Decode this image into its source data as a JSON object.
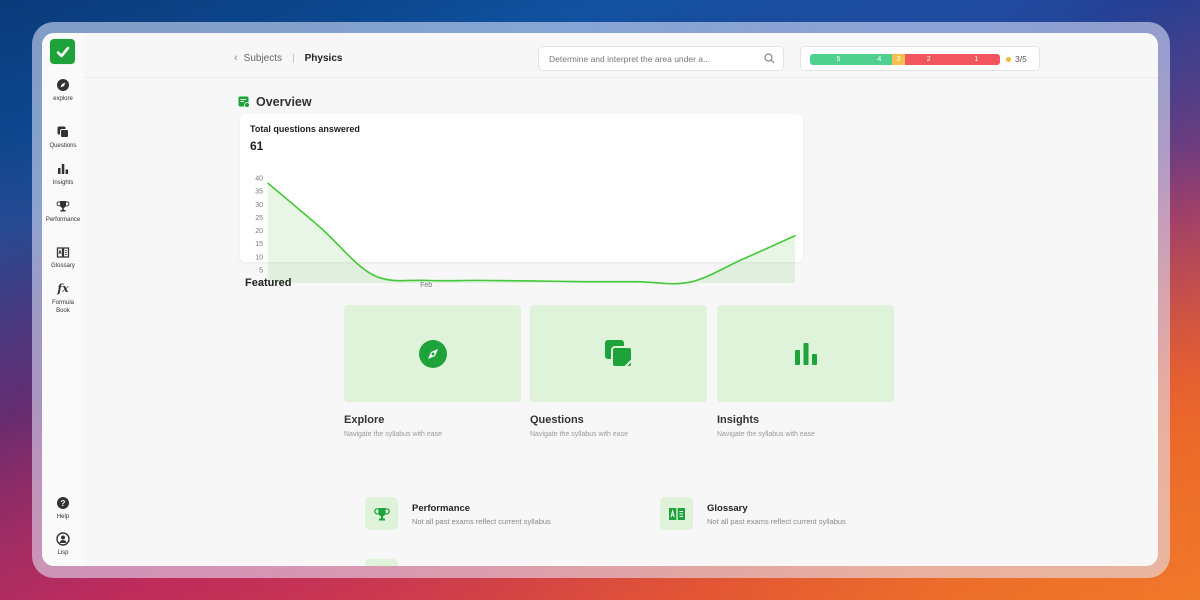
{
  "colors": {
    "accent": "#1ea23a",
    "card_bg": "#dff2da",
    "line": "#45c83a"
  },
  "sidebar": {
    "items": [
      {
        "label": "explore",
        "icon": "compass-icon"
      },
      {
        "label": "Questions",
        "icon": "cards-icon"
      },
      {
        "label": "Insights",
        "icon": "bar-chart-icon"
      },
      {
        "label": "Performance",
        "icon": "trophy-icon"
      },
      {
        "label": "Glossary",
        "icon": "book-icon"
      },
      {
        "label": "Formula Book",
        "icon": "fx-icon"
      }
    ],
    "bottom": [
      {
        "label": "Help",
        "icon": "help-icon"
      },
      {
        "label": "Lisp",
        "icon": "user-icon"
      }
    ]
  },
  "header": {
    "breadcrumb_parent": "Subjects",
    "breadcrumb_current": "Physics",
    "search_placeholder": "Determine and interpret the area under a...",
    "score_segments": [
      {
        "label": "5",
        "color": "#4fd08f",
        "fraction": 0.3
      },
      {
        "label": "4",
        "color": "#4fd08f",
        "fraction": 0.13
      },
      {
        "label": "3",
        "color": "#f6c04a",
        "fraction": 0.07
      },
      {
        "label": "2",
        "color": "#f2555e",
        "fraction": 0.25
      },
      {
        "label": "1",
        "color": "#f2555e",
        "fraction": 0.25
      }
    ],
    "score_text": "3/5"
  },
  "overview": {
    "title": "Overview",
    "chart_title": "Total questions answered",
    "total": "61"
  },
  "chart_data": {
    "type": "area",
    "x": [
      0,
      1,
      2,
      3,
      4,
      5,
      6,
      7,
      8,
      9,
      10
    ],
    "x_tick_labels": [
      "Feb"
    ],
    "values": [
      38,
      21,
      3,
      1,
      1,
      0.8,
      0.5,
      0.5,
      0.3,
      9,
      18
    ],
    "ylim": [
      0,
      40
    ],
    "yticks": [
      "0",
      "5",
      "10",
      "15",
      "20",
      "25",
      "30",
      "35",
      "40"
    ],
    "title": "Total questions answered",
    "grid": false
  },
  "featured": {
    "title": "Featured",
    "cards": [
      {
        "title": "Explore",
        "subtitle": "Navigate the syllabus with ease",
        "icon": "compass-icon"
      },
      {
        "title": "Questions",
        "subtitle": "Navigate the syllabus with ease",
        "icon": "cards-icon"
      },
      {
        "title": "Insights",
        "subtitle": "Navigate the syllabus with ease",
        "icon": "bar-chart-icon"
      }
    ],
    "mini": [
      {
        "title": "Performance",
        "subtitle": "Not all past exams reflect current syllabus",
        "icon": "trophy-icon"
      },
      {
        "title": "Glossary",
        "subtitle": "Not all past exams reflect current syllabus",
        "icon": "book-icon"
      }
    ]
  }
}
